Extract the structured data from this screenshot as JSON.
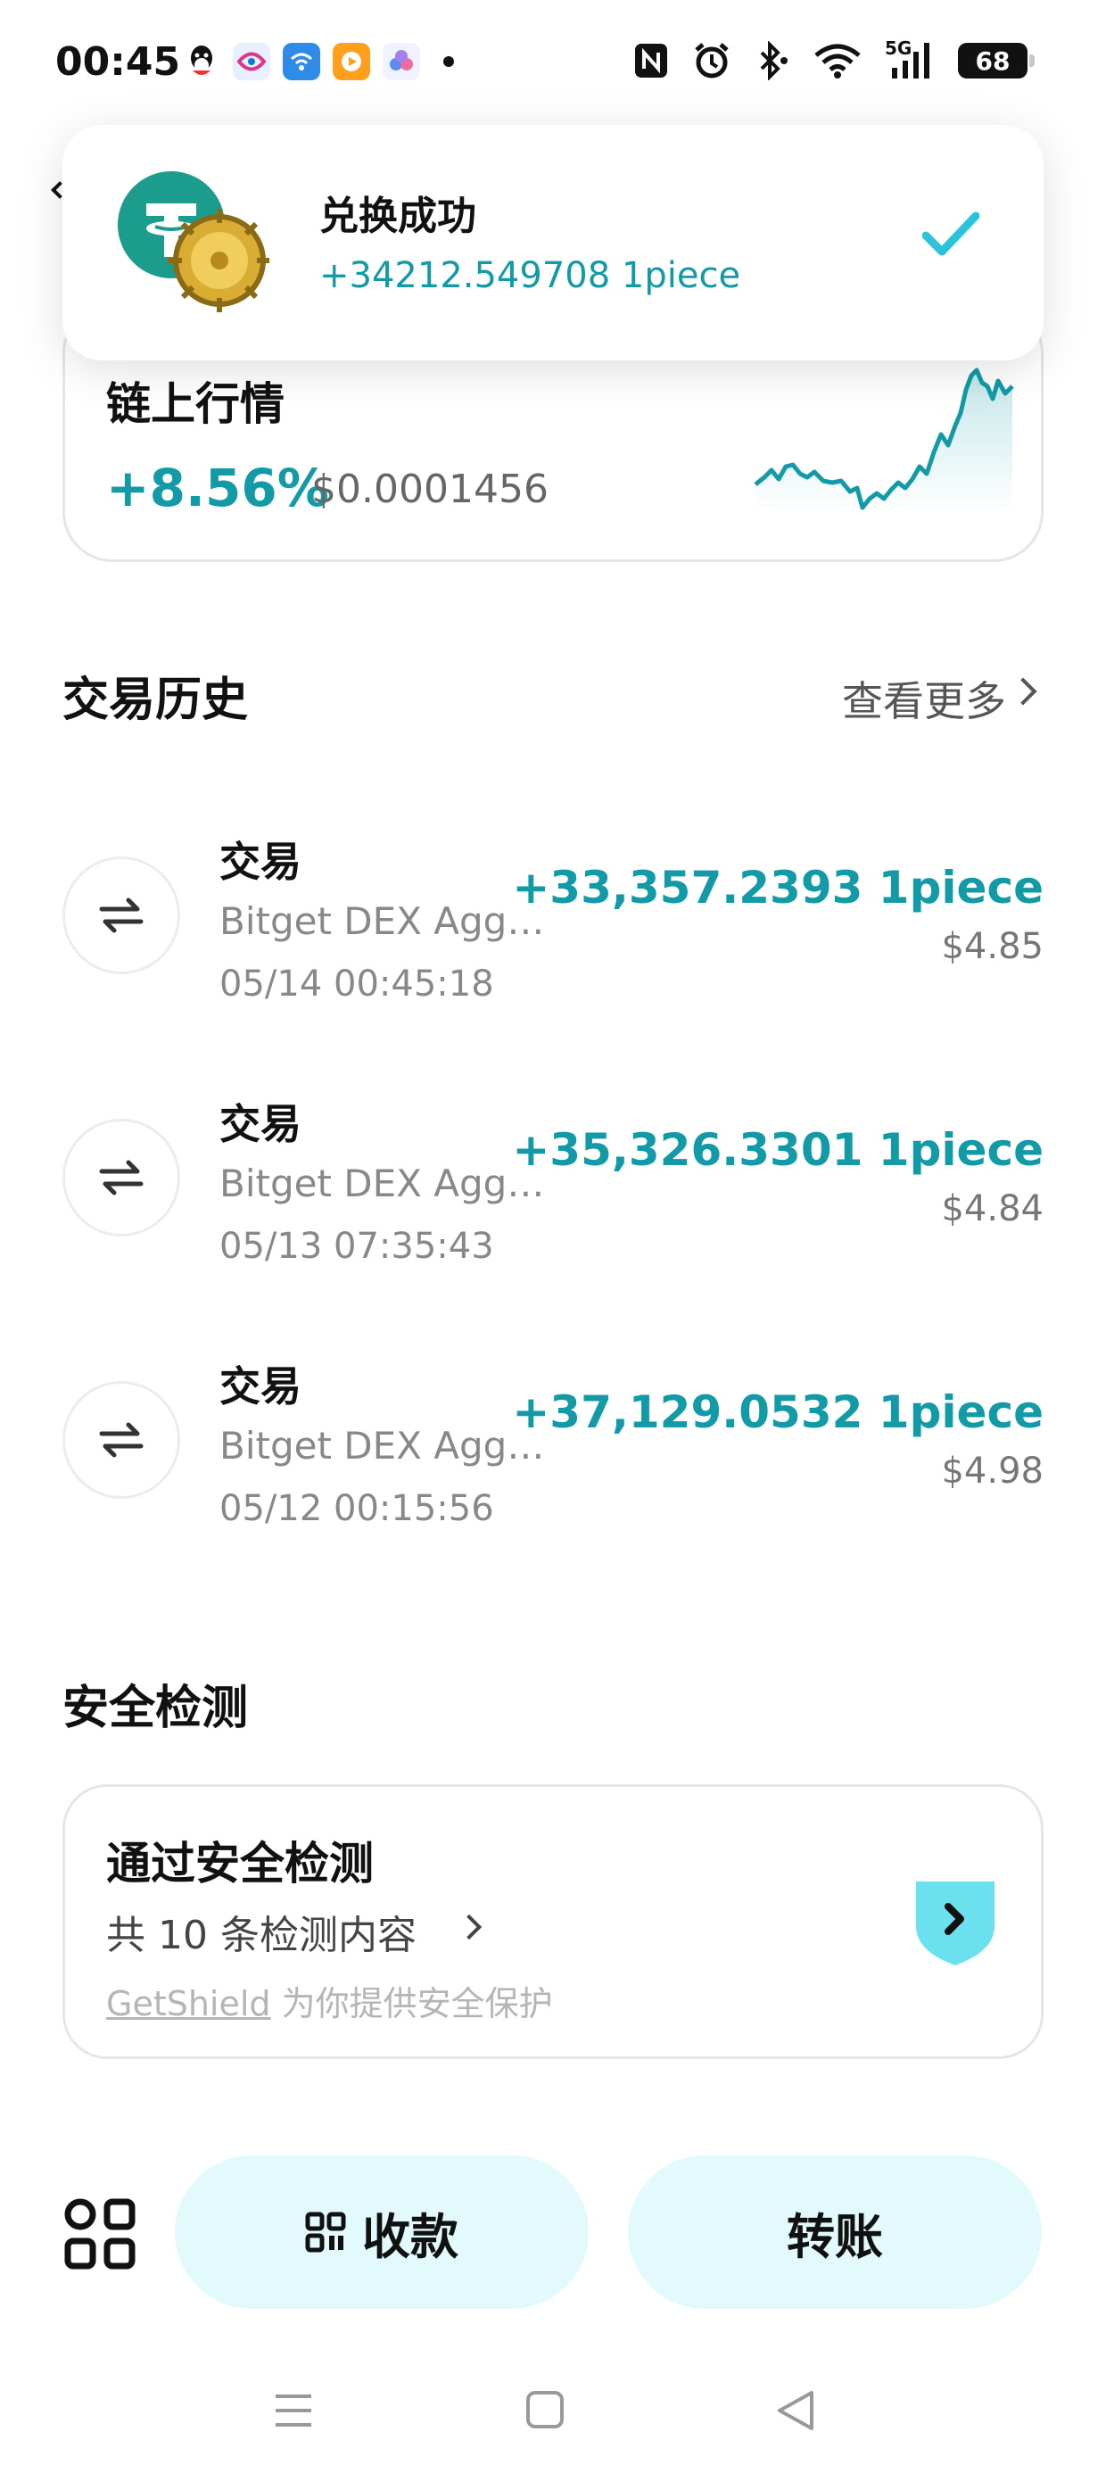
{
  "status_bar": {
    "time": "00:45",
    "network": "5G",
    "battery": "68"
  },
  "toast": {
    "title": "兑换成功",
    "amount": "+34212.549708 1piece",
    "check_color": "#2bc3d9"
  },
  "market": {
    "title": "链上行情",
    "change": "+8.56%",
    "price": "$0.0001456",
    "accent": "#129aa7"
  },
  "history": {
    "title": "交易历史",
    "see_more": "查看更多",
    "items": [
      {
        "type": "交易",
        "source": "Bitget DEX Aggregator",
        "time": "05/14 00:45:18",
        "amount": "+33,357.2393 1piece",
        "usd": "$4.85"
      },
      {
        "type": "交易",
        "source": "Bitget DEX Aggregator",
        "time": "05/13 07:35:43",
        "amount": "+35,326.3301 1piece",
        "usd": "$4.84"
      },
      {
        "type": "交易",
        "source": "Bitget DEX Aggregator",
        "time": "05/12 00:15:56",
        "amount": "+37,129.0532 1piece",
        "usd": "$4.98"
      }
    ]
  },
  "security": {
    "section_title": "安全检测",
    "title": "通过安全检测",
    "count": "共 10 条检测内容",
    "note_brand": "GetShield",
    "note_text": " 为你提供安全保护",
    "shield_color": "#6be1ef"
  },
  "actions": {
    "receive": "收款",
    "transfer": "转账"
  }
}
